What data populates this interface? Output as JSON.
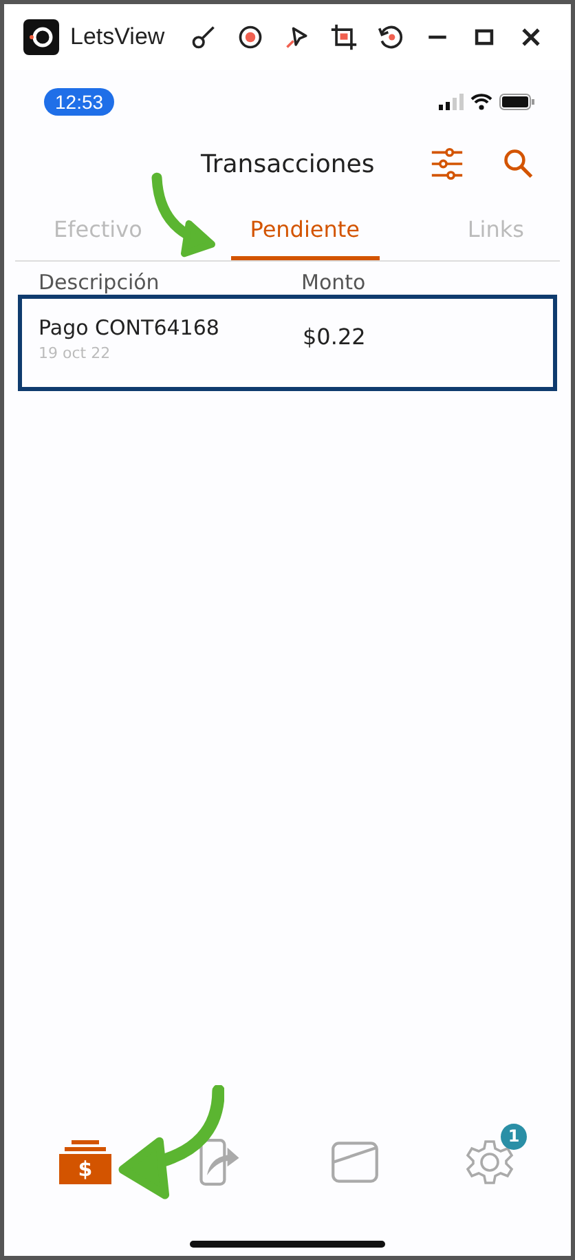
{
  "window": {
    "title": "LetsView"
  },
  "status_bar": {
    "time": "12:53"
  },
  "header": {
    "title": "Transacciones"
  },
  "tabs": [
    {
      "label": "Efectivo",
      "selected": false
    },
    {
      "label": "Pendiente",
      "selected": true
    },
    {
      "label": "Links",
      "selected": false
    }
  ],
  "table": {
    "columns": [
      "Descripción",
      "Monto"
    ],
    "rows": [
      {
        "description": "Pago CONT64168",
        "date": "19 oct 22",
        "amount": "$0.22",
        "highlighted": true
      }
    ]
  },
  "bottom_nav": [
    {
      "kind": "cash",
      "selected": true,
      "glyph": "$"
    },
    {
      "kind": "transfer",
      "selected": false
    },
    {
      "kind": "card",
      "selected": false
    },
    {
      "kind": "settings",
      "selected": false,
      "badge": "1"
    }
  ]
}
